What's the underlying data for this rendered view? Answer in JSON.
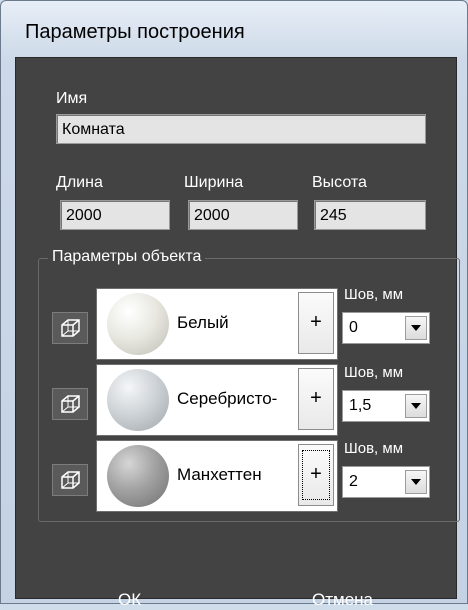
{
  "window": {
    "title": "Параметры построения"
  },
  "form": {
    "name_label": "Имя",
    "name_value": "Комната",
    "length_label": "Длина",
    "length_value": "2000",
    "width_label": "Ширина",
    "width_value": "2000",
    "height_label": "Высота",
    "height_value": "245"
  },
  "object_params": {
    "title": "Параметры объекта",
    "materials": [
      {
        "name": "Белый",
        "add_label": "+",
        "seam_label": "Шов, мм",
        "seam_value": "0",
        "sphere_color": "#e9e9e2"
      },
      {
        "name": "Серебристо-",
        "add_label": "+",
        "seam_label": "Шов, мм",
        "seam_value": "1,5",
        "sphere_color": "#cfd4d8"
      },
      {
        "name": "Манхеттен",
        "add_label": "+",
        "seam_label": "Шов, мм",
        "seam_value": "2",
        "sphere_color": "#a2a2a2"
      }
    ]
  },
  "buttons": {
    "ok": "ОК",
    "cancel": "Отмена"
  },
  "colors": {
    "panel": "#434343",
    "titlebar": "#cfdcea"
  }
}
